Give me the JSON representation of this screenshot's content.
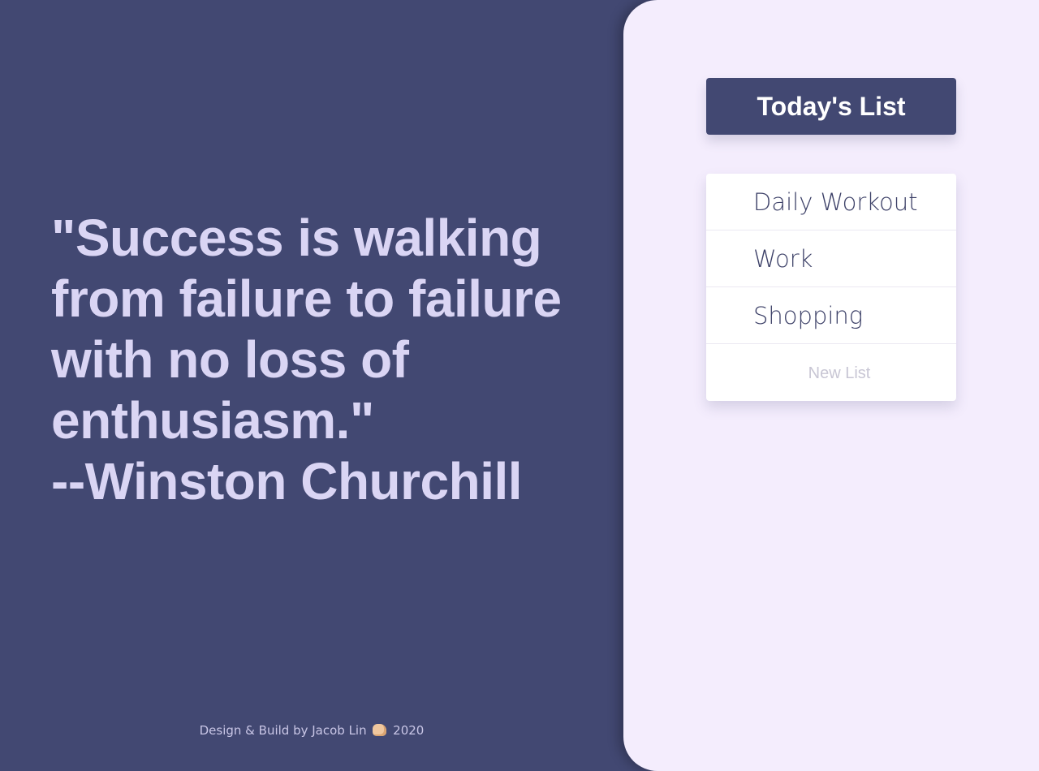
{
  "quote": {
    "lines": [
      "\"Success is walking",
      "from failure to failure",
      "with no loss of",
      "enthusiasm.\"",
      "--Winston Churchill"
    ]
  },
  "footer": {
    "text_before": "Design & Build by Jacob Lin",
    "icon": "fist-bump-emoji",
    "text_after": "2020"
  },
  "sidebar": {
    "title": "Today's List",
    "lists": [
      {
        "label": "Daily Workout"
      },
      {
        "label": "Work"
      },
      {
        "label": "Shopping"
      }
    ],
    "new_list_placeholder": "New List"
  },
  "colors": {
    "primary": "#424872",
    "quote_text": "#dad5f4",
    "panel_background": "#f4edfd",
    "card_background": "#ffffff",
    "list_text": "#3d4168",
    "placeholder_text": "#c8c6d4"
  }
}
